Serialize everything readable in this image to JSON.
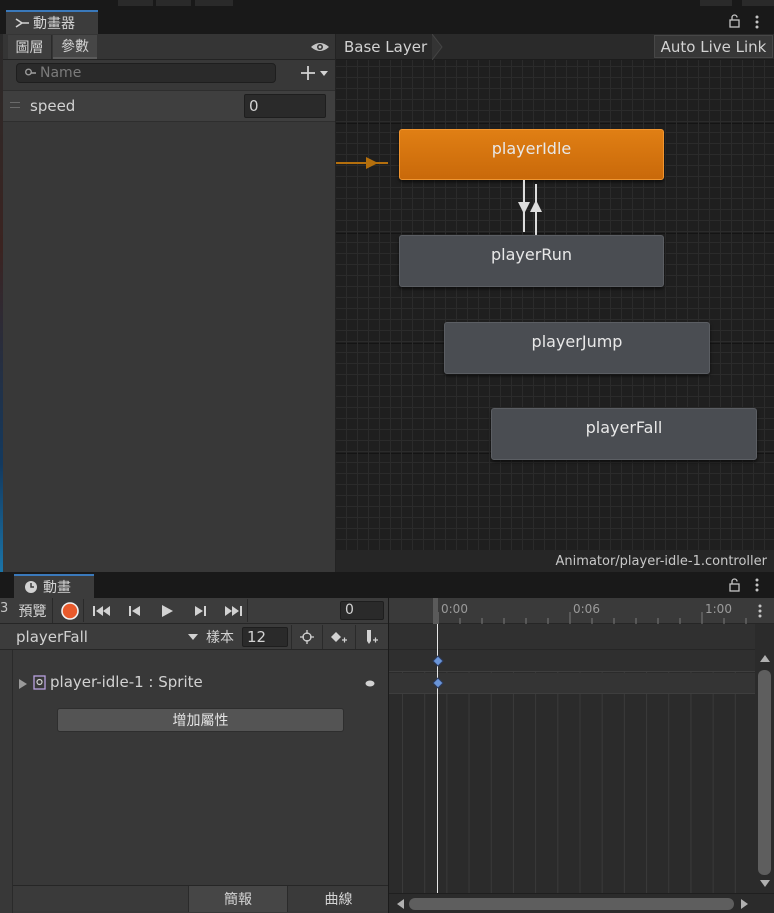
{
  "animator": {
    "tab_label": "動畫器",
    "left_tabs": [
      "圖層",
      "參數"
    ],
    "search_placeholder": "Name",
    "params": [
      {
        "name": "speed",
        "value": "0"
      }
    ],
    "breadcrumb": "Base Layer",
    "live_link": "Auto Live Link",
    "states": [
      {
        "name": "playerIdle",
        "default": true
      },
      {
        "name": "playerRun"
      },
      {
        "name": "playerJump"
      },
      {
        "name": "playerFall"
      }
    ],
    "footer_path": "Animator/player-idle-1.controller"
  },
  "animation": {
    "tab_label": "動畫",
    "left_stub": "3",
    "preview_label": "預覽",
    "frame_value": "0",
    "clip_name": "playerFall",
    "samples_label": "樣本",
    "samples_value": "12",
    "property_label": "player-idle-1 : Sprite",
    "add_property_label": "增加屬性",
    "footer_tabs": [
      "簡報",
      "曲線"
    ],
    "ruler_ticks": [
      "0:00",
      "0:06",
      "1:00"
    ]
  },
  "colors": {
    "accent_tab": "#3a79bb",
    "state_default": "#e07f14",
    "state": "#4a4d52",
    "record": "#e85a2c",
    "keyframe": "#6a95d8"
  }
}
